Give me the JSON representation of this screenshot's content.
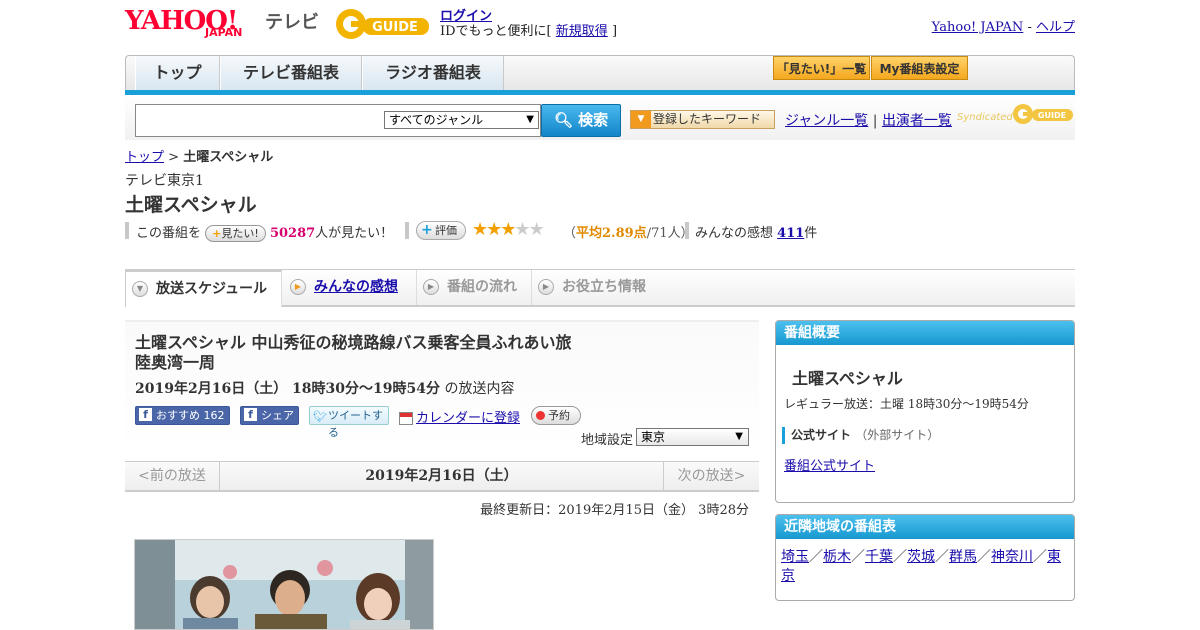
{
  "header": {
    "yahoo_logo": "YAHOO!",
    "yahoo_japan": "JAPAN",
    "tv_label": "テレビ",
    "gguide_logo": "G-GUIDE",
    "login": "ログイン",
    "id_text": "IDでもっと便利に[",
    "signup": "新規取得",
    "id_close": "]",
    "yahoo_japan_link": "Yahoo! JAPAN",
    "separator": "-",
    "help": "ヘルプ"
  },
  "nav": {
    "tabs": [
      "トップ",
      "テレビ番組表",
      "ラジオ番組表"
    ],
    "mitai_list": "「見たい!」一覧",
    "my_schedule": "My番組表設定"
  },
  "search": {
    "placeholder": "",
    "genre": "すべてのジャンル",
    "button": "検索",
    "keyword_button": "登録したキーワード",
    "genre_list": "ジャンル一覧",
    "divider": "|",
    "performer_list": "出演者一覧",
    "syndicated": "Syndicated"
  },
  "breadcrumb": {
    "top": "トップ",
    "sep": ">",
    "current": "土曜スペシャル"
  },
  "program": {
    "channel": "テレビ東京1",
    "title": "土曜スペシャル",
    "this_program": "この番組を",
    "mitai_button": "見たい!",
    "mitai_count": "50287",
    "mitai_suffix": "人が見たい！",
    "hyoka_button": "評価",
    "rating_stars": 2.89,
    "rating_open": "（",
    "rating_avg": "平均2.89点",
    "rating_people": "/71人）",
    "kansou_label": "みんなの感想",
    "kansou_count": "411",
    "kansou_suffix": "件"
  },
  "subtabs": [
    "放送スケジュール",
    "みんなの感想",
    "番組の流れ",
    "お役立ち情報"
  ],
  "episode": {
    "title": "土曜スペシャル 中山秀征の秘境路線バス乗客全員ふれあい旅 陸奥湾一周",
    "date": "2019年2月16日（土） 18時30分～19時54分",
    "date_suffix": "の放送内容",
    "fb_recommend": "おすすめ",
    "fb_count": "162",
    "fb_share": "シェア",
    "tweet": "ツイートする",
    "calendar": "カレンダーに登録",
    "reserve": "予約",
    "region_label": "地域設定",
    "region_value": "東京"
  },
  "datenav": {
    "prev": "<前の放送",
    "current": "2019年2月16日（土）",
    "next": "次の放送>"
  },
  "updated": "最終更新日：2019年2月15日（金） 3時28分",
  "sidebar": {
    "overview_header": "番組概要",
    "overview_title": "土曜スペシャル",
    "regular": "レギュラー放送：土曜 18時30分～19時54分",
    "official_label": "公式サイト",
    "official_note": "（外部サイト）",
    "official_link": "番組公式サイト",
    "nearby_header": "近隣地域の番組表",
    "areas": [
      "埼玉",
      "栃木",
      "千葉",
      "茨城",
      "群馬",
      "神奈川",
      "東京"
    ]
  },
  "colors": {
    "accent_blue": "#1aa0d8",
    "link": "#1a0dab",
    "pink_count": "#d6006f",
    "rating_orange": "#e08a00"
  }
}
